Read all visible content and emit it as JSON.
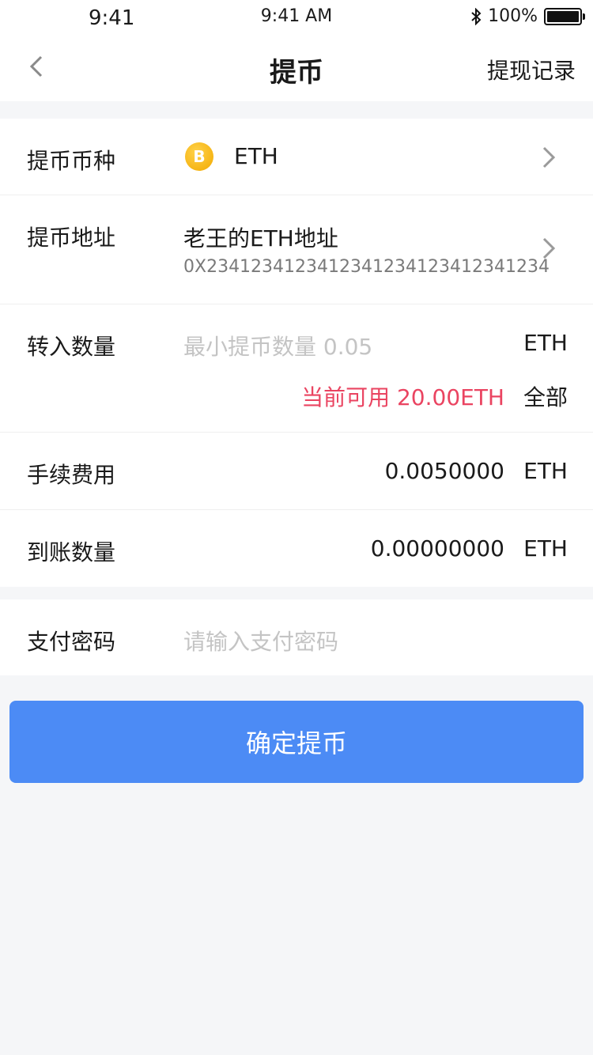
{
  "status_bar": {
    "time_left": "9:41",
    "time_center": "9:41 AM",
    "battery_text": "100%",
    "battery_level_percent": 100,
    "icons": [
      "bluetooth-icon",
      "battery-icon"
    ]
  },
  "nav": {
    "back_icon": "chevron-left-icon",
    "title": "提币",
    "right_link": "提现记录"
  },
  "form": {
    "coin": {
      "label": "提币币种",
      "icon": "bitcoin-coin-icon",
      "icon_letter": "B",
      "value": "ETH"
    },
    "address": {
      "label": "提币地址",
      "name": "老王的ETH地址",
      "hash": "0X2341234123412341234123412341234"
    },
    "amount": {
      "label": "转入数量",
      "placeholder": "最小提币数量 0.05",
      "unit": "ETH",
      "available": "当前可用 20.00ETH",
      "all_button": "全部"
    },
    "fee": {
      "label": "手续费用",
      "value": "0.0050000",
      "unit": "ETH"
    },
    "received": {
      "label": "到账数量",
      "value": "0.00000000",
      "unit": "ETH"
    },
    "password": {
      "label": "支付密码",
      "placeholder": "请输入支付密码"
    }
  },
  "confirm_button": "确定提币",
  "colors": {
    "accent": "#4c8bf5",
    "available_text": "#ea4461",
    "background": "#f5f6f8"
  }
}
